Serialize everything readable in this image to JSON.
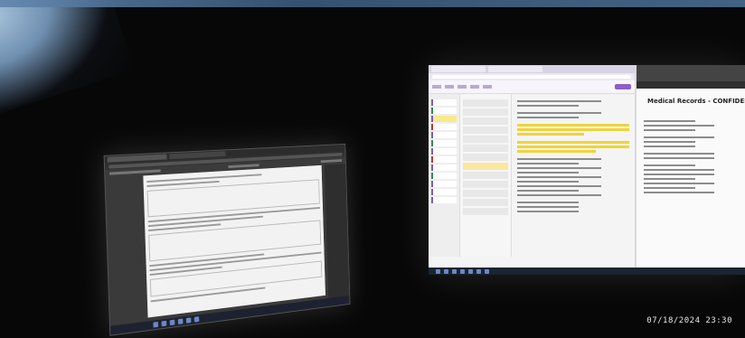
{
  "scene": {
    "description_elements": [
      "left-monitor",
      "right-monitor"
    ]
  },
  "right_monitor": {
    "document_heading": "Medical Records - CONFIDENTIAL"
  },
  "overlay": {
    "timestamp": "07/18/2024  23:30"
  },
  "colors": {
    "background": "#070707",
    "highlight": "#f1d33a",
    "onenote_accent": "#8d5ec7",
    "taskbar": "#1a2533"
  }
}
